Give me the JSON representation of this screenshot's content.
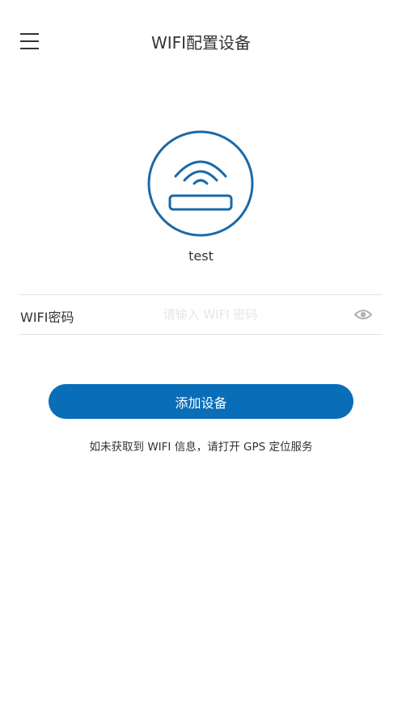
{
  "header": {
    "title": "WIFI配置设备",
    "menu_icon": "hamburger-menu-icon"
  },
  "device": {
    "icon": "wifi-router-icon",
    "name": "test"
  },
  "password": {
    "label": "WIFI密码",
    "placeholder": "请输入 WIFI 密码",
    "value": "",
    "toggle_icon": "eye-icon"
  },
  "actions": {
    "add_device_label": "添加设备"
  },
  "hint": {
    "text": "如未获取到 WIFI 信息，请打开 GPS 定位服务"
  },
  "colors": {
    "accent": "#0A6DB8",
    "icon_stroke": "#1A69A8",
    "eye_icon": "#B0B0B0"
  }
}
